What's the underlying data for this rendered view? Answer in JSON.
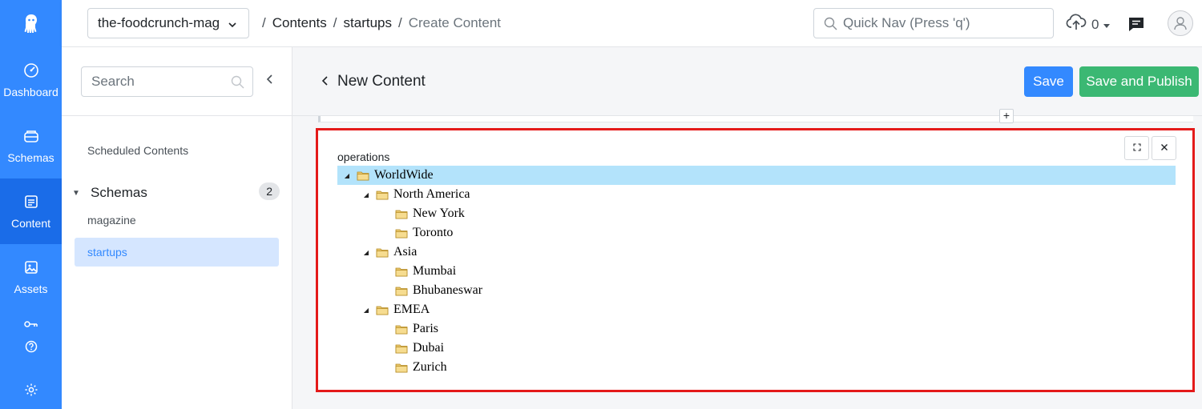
{
  "rail": {
    "items": [
      {
        "label": "Dashboard",
        "icon": "dashboard-icon"
      },
      {
        "label": "Schemas",
        "icon": "schemas-icon"
      },
      {
        "label": "Content",
        "icon": "content-icon"
      },
      {
        "label": "Assets",
        "icon": "assets-icon"
      }
    ],
    "active": "Content",
    "accent": "#3389ff"
  },
  "topbar": {
    "app_name": "the-foodcrunch-mag",
    "breadcrumb": [
      "Contents",
      "startups",
      "Create Content"
    ],
    "quicknav_placeholder": "Quick Nav (Press 'q')",
    "upload_count": "0"
  },
  "sidebar": {
    "search_placeholder": "Search",
    "scheduled_label": "Scheduled Contents",
    "schemas_label": "Schemas",
    "schemas_count": "2",
    "schemas": [
      {
        "name": "magazine",
        "active": false
      },
      {
        "name": "startups",
        "active": true
      }
    ]
  },
  "main": {
    "title": "New Content",
    "save_label": "Save",
    "publish_label": "Save and Publish",
    "add_label": "+",
    "field_label": "operations",
    "tree": [
      {
        "label": "WorldWide",
        "level": 0,
        "expanded": true,
        "selected": true
      },
      {
        "label": "North America",
        "level": 1,
        "expanded": true
      },
      {
        "label": "New York",
        "level": 2
      },
      {
        "label": "Toronto",
        "level": 2
      },
      {
        "label": "Asia",
        "level": 1,
        "expanded": true
      },
      {
        "label": "Mumbai",
        "level": 2
      },
      {
        "label": "Bhubaneswar",
        "level": 2
      },
      {
        "label": "EMEA",
        "level": 1,
        "expanded": true
      },
      {
        "label": "Paris",
        "level": 2
      },
      {
        "label": "Dubai",
        "level": 2
      },
      {
        "label": "Zurich",
        "level": 2
      }
    ]
  },
  "colors": {
    "save": "#3389ff",
    "publish": "#3bb873",
    "highlight": "#e41a1a",
    "selected_node": "#b3e3fb"
  }
}
